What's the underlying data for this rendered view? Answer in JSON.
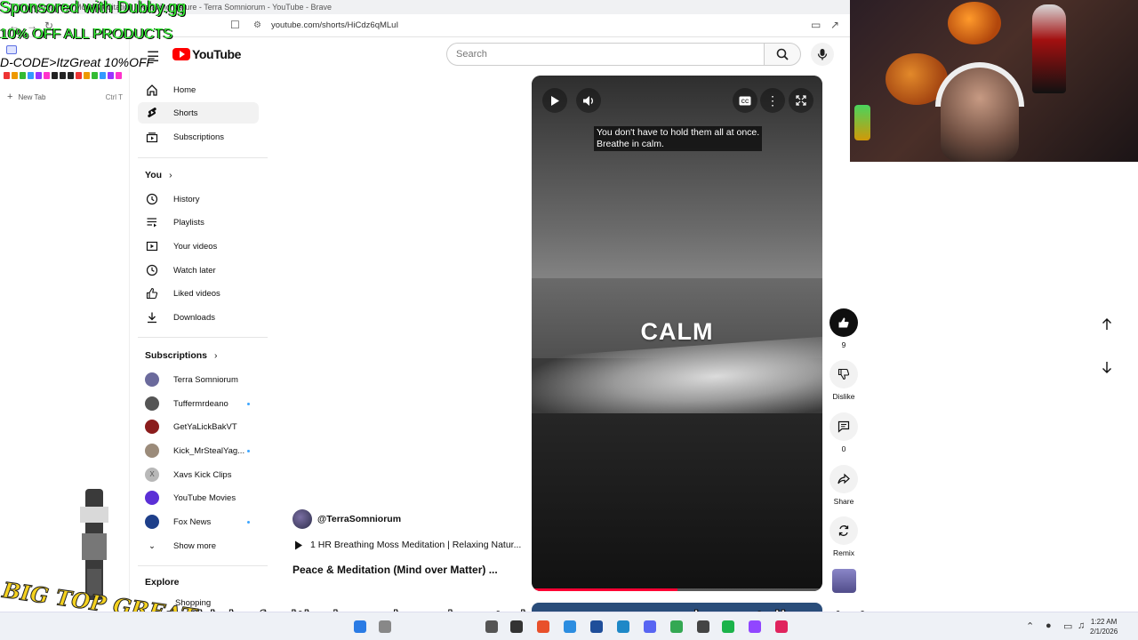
{
  "browser": {
    "window_title": "1 HR Breathing Moss Meditation | Relaxing Nature - Terra Somniorum - YouTube - Brave",
    "url": "youtube.com/shorts/HiCdz6qMLuI",
    "new_tab_label": "New Tab",
    "new_tab_shortcut": "Ctrl T"
  },
  "overlay": {
    "sponsor": "Sponsored with Dubby.gg",
    "discount": "10% OFF ALL PRODUCTS",
    "code": "D-CODE>ItzGreat 10%OFF",
    "logo_text": "BIG TOP GREAT",
    "stream_caption": "ng to think of critical angels on how to improve we can always talk post stream"
  },
  "youtube": {
    "logo_word": "YouTube",
    "search_placeholder": "Search",
    "nav": [
      {
        "label": "Home",
        "icon": "home-icon"
      },
      {
        "label": "Shorts",
        "icon": "shorts-icon"
      },
      {
        "label": "Subscriptions",
        "icon": "subscriptions-icon"
      }
    ],
    "you_heading": "You",
    "you_items": [
      {
        "label": "History",
        "icon": "history-icon"
      },
      {
        "label": "Playlists",
        "icon": "playlists-icon"
      },
      {
        "label": "Your videos",
        "icon": "your-videos-icon"
      },
      {
        "label": "Watch later",
        "icon": "watch-later-icon"
      },
      {
        "label": "Liked videos",
        "icon": "liked-videos-icon"
      },
      {
        "label": "Downloads",
        "icon": "downloads-icon"
      }
    ],
    "subscriptions_heading": "Subscriptions",
    "subscriptions": [
      {
        "label": "Terra Somniorum",
        "color": "#6b6a9c",
        "dot": false
      },
      {
        "label": "Tuffermrdeano",
        "color": "#555555",
        "dot": true
      },
      {
        "label": "GetYaLickBakVT",
        "color": "#8b1c1c",
        "dot": false
      },
      {
        "label": "Kick_MrStealYag...",
        "color": "#9b8b7a",
        "dot": true
      },
      {
        "label": "Xavs Kick Clips",
        "color": "#b8b8b8",
        "dot": false,
        "letter": "X"
      },
      {
        "label": "YouTube Movies",
        "color": "#5b2fd6",
        "dot": false
      },
      {
        "label": "Fox News",
        "color": "#1e3f8a",
        "dot": true
      }
    ],
    "show_more": "Show more",
    "explore_heading": "Explore",
    "explore_first": "Shopping"
  },
  "short": {
    "caption_line": "You don't have to hold them all at once.\nBreathe in calm.",
    "overlay_word": "CALM",
    "progress": 0.5,
    "channel": "@TerraSomniorum",
    "playlist": "1 HR Breathing Moss Meditation | Relaxing Natur...",
    "title": "Peace & Meditation (Mind over Matter) ...",
    "likes": "9",
    "dislike_label": "Dislike",
    "comments": "0",
    "share_label": "Share",
    "remix_label": "Remix"
  },
  "taskbar": {
    "time": "1:22 AM",
    "date": "2/1/2026"
  }
}
